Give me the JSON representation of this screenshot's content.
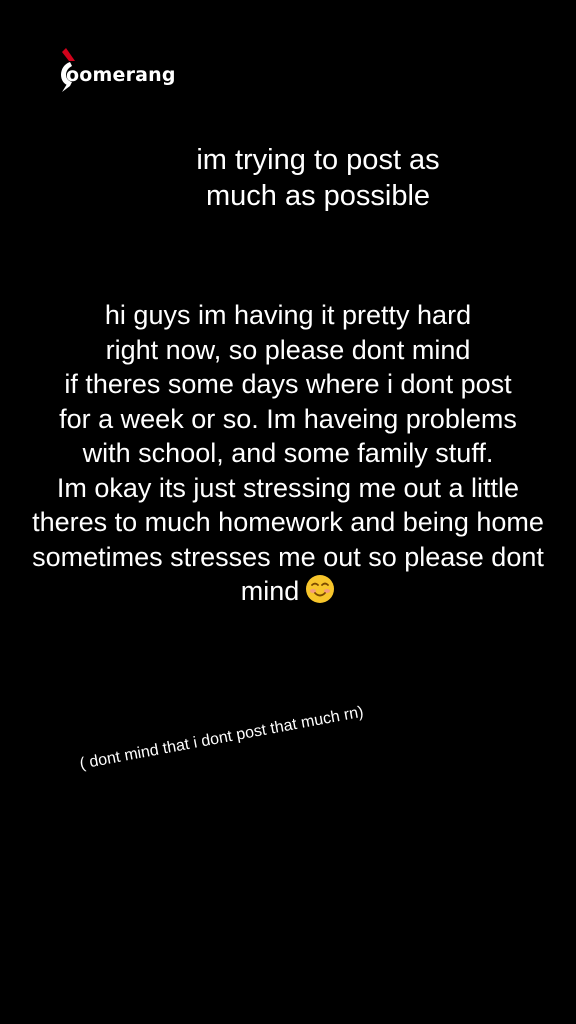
{
  "watermark": {
    "text": "oomerang"
  },
  "heading": {
    "lines": [
      "im trying to post as",
      "much as possible"
    ]
  },
  "message": {
    "lines": [
      "hi guys im having it pretty hard",
      "right now, so please dont mind",
      "if theres some days where i dont post",
      "for a week or so. Im haveing problems",
      "with school, and some family stuff.",
      "Im okay its just stressing me out a little",
      "theres to much homework and being home",
      "sometimes stresses me out so please dont",
      "mind"
    ],
    "emoji": "smiling-face-icon"
  },
  "side_note": {
    "text": "( dont mind that i dont post that much rn)"
  },
  "colors": {
    "background": "#000000",
    "text": "#ffffff",
    "logo_accent": "#d0021b",
    "emoji_face": "#f7c52b"
  }
}
